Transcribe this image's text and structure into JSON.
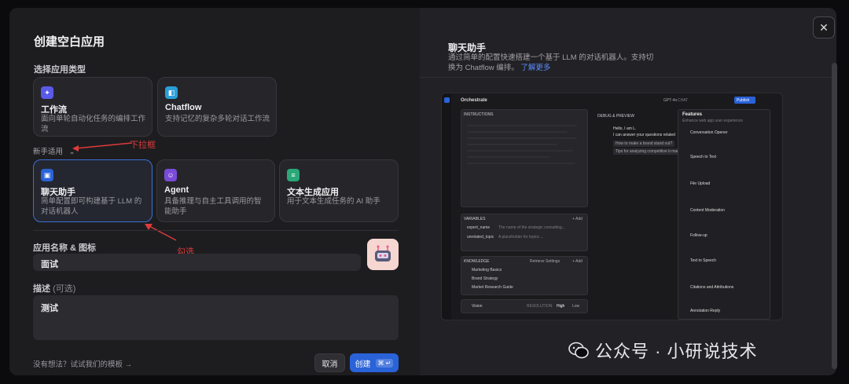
{
  "dialog": {
    "title": "创建空白应用",
    "type_label": "选择应用类型",
    "app_types_top": [
      {
        "name": "工作流",
        "desc": "面向单轮自动化任务的编排工作流",
        "icon": "workflow-icon",
        "color": "#5a5ae8"
      },
      {
        "name": "Chatflow",
        "desc": "支持记忆的复杂多轮对话工作流",
        "icon": "chatflow-icon",
        "color": "#2a9fd8"
      }
    ],
    "newbie_label": "新手适用",
    "app_types_bottom": [
      {
        "name": "聊天助手",
        "desc": "简单配置即可构建基于 LLM 的对话机器人",
        "icon": "chat-assistant-icon",
        "color": "#2a62d8",
        "selected": true
      },
      {
        "name": "Agent",
        "desc": "具备推理与自主工具调用的智能助手",
        "icon": "agent-icon",
        "color": "#7a4ad8",
        "selected": false
      },
      {
        "name": "文本生成应用",
        "desc": "用于文本生成任务的 AI 助手",
        "icon": "text-gen-icon",
        "color": "#2aa87a",
        "selected": false
      }
    ],
    "annotation_dropdown": "下拉框",
    "annotation_check": "勾选",
    "name_label": "应用名称 & 图标",
    "name_value": "面试",
    "desc_label": "描述",
    "desc_optional": "(可选)",
    "desc_value": "测试",
    "template_link": "没有想法？试试我们的模板 →",
    "cancel_label": "取消",
    "create_label": "创建",
    "create_shortcut": "⌘ ↵"
  },
  "preview": {
    "title": "聊天助手",
    "desc": "通过简单的配置快速搭建一个基于 LLM 的对话机器人。支持切换为 Chatflow 编排。",
    "learn_more": "了解更多",
    "shot": {
      "orchestrate": "Orchestrate",
      "model": "GPT-4o",
      "chat_tag": "CHAT",
      "publish": "Publish",
      "instructions": "INSTRUCTIONS",
      "debug": "DEBUG & PREVIEW",
      "hello": "Hello, I am L.",
      "hello2": "I can answer your questions related",
      "q1": "How to make a brand stand out?",
      "q2": "Tips for analyzing competitive b marke",
      "variables": "VARIABLES",
      "var1": "expert_name",
      "var1d": "The name of the strategic consulting...",
      "var2": "unrelated_topic",
      "var2d": "A placeholder for topics ...",
      "knowledge": "KNOWLEDGE",
      "kb_settings": "Retrieve Settings",
      "add": "+ Add",
      "kb1": "Marketing Basics",
      "kb2": "Brand Strategy",
      "kb3": "Market Research Guide",
      "vision": "Vision",
      "resolution": "RESOLUTION",
      "high": "High",
      "low": "Low",
      "features": "Features",
      "features_sub": "Enhance web app user experience",
      "f1": "Conversation Opener",
      "f2": "Speech to Text",
      "f3": "File Upload",
      "f4": "Content Moderation",
      "f5": "Follow-up",
      "f6": "Text to Speech",
      "f7": "Citations and Attributions",
      "f8": "Annotation Reply"
    }
  },
  "watermark": "公众号 · 小研说技术"
}
